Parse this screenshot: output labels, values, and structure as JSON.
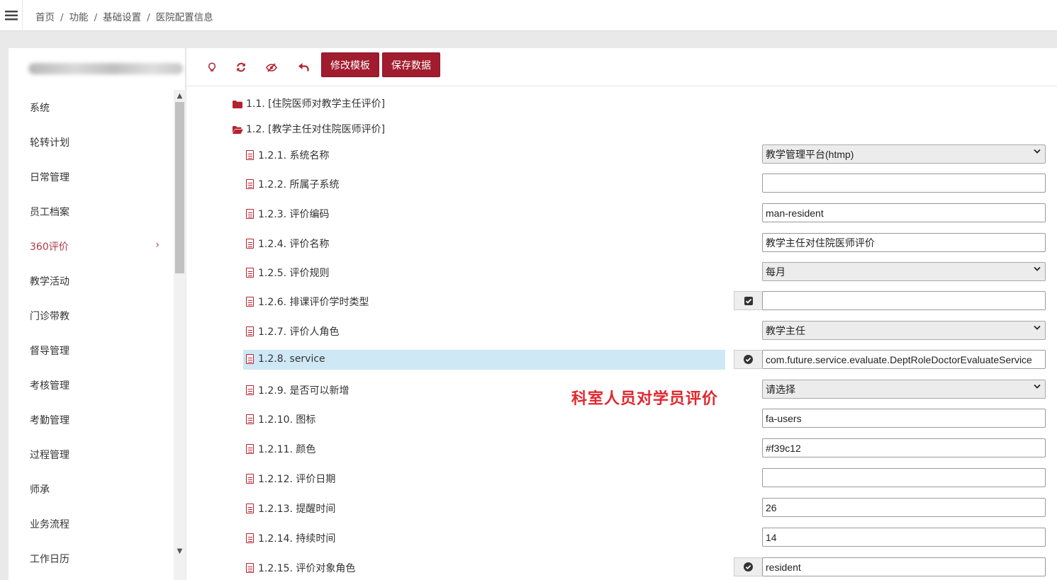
{
  "breadcrumb": [
    "首页",
    "功能",
    "基础设置",
    "医院配置信息"
  ],
  "sidebar": {
    "items": [
      {
        "label": "系统",
        "active": false
      },
      {
        "label": "轮转计划",
        "active": false
      },
      {
        "label": "日常管理",
        "active": false
      },
      {
        "label": "员工档案",
        "active": false
      },
      {
        "label": "360评价",
        "active": true
      },
      {
        "label": "教学活动",
        "active": false
      },
      {
        "label": "门诊带教",
        "active": false
      },
      {
        "label": "督导管理",
        "active": false
      },
      {
        "label": "考核管理",
        "active": false
      },
      {
        "label": "考勤管理",
        "active": false
      },
      {
        "label": "过程管理",
        "active": false
      },
      {
        "label": "师承",
        "active": false
      },
      {
        "label": "业务流程",
        "active": false
      },
      {
        "label": "工作日历",
        "active": false
      }
    ]
  },
  "toolbar": {
    "icons": [
      "lightbulb-icon",
      "refresh-icon",
      "eye-slash-icon",
      "undo-icon"
    ],
    "edit_template": "修改模板",
    "save_data": "保存数据"
  },
  "tree": {
    "node1": "1.1. [住院医师对教学主任评价]",
    "node2": "1.2. [教学主任对住院医师评价]",
    "rows": [
      {
        "label": "1.2.1. 系统名称",
        "type": "select",
        "value": "教学管理平台(htmp)"
      },
      {
        "label": "1.2.2. 所属子系统",
        "type": "input",
        "value": ""
      },
      {
        "label": "1.2.3. 评价编码",
        "type": "input",
        "value": "man-resident"
      },
      {
        "label": "1.2.4. 评价名称",
        "type": "input",
        "value": "教学主任对住院医师评价"
      },
      {
        "label": "1.2.5. 评价规则",
        "type": "select",
        "value": "每月"
      },
      {
        "label": "1.2.6. 排课评价学时类型",
        "type": "input",
        "value": "",
        "addon": "check-square-icon"
      },
      {
        "label": "1.2.7. 评价人角色",
        "type": "select",
        "value": "教学主任"
      },
      {
        "label": "1.2.8. service",
        "type": "input",
        "value": "com.future.service.evaluate.DeptRoleDoctorEvaluateService",
        "addon": "check-circle-icon",
        "highlight": true
      },
      {
        "label": "1.2.9. 是否可以新增",
        "type": "select",
        "value": "请选择"
      },
      {
        "label": "1.2.10. 图标",
        "type": "input",
        "value": "fa-users"
      },
      {
        "label": "1.2.11. 颜色",
        "type": "input",
        "value": "#f39c12"
      },
      {
        "label": "1.2.12. 评价日期",
        "type": "input",
        "value": ""
      },
      {
        "label": "1.2.13. 提醒时间",
        "type": "input",
        "value": "26"
      },
      {
        "label": "1.2.14. 持续时间",
        "type": "input",
        "value": "14"
      },
      {
        "label": "1.2.15. 评价对象角色",
        "type": "input",
        "value": "resident",
        "addon": "check-circle-icon"
      }
    ]
  },
  "annotation": "科室人员对学员评价",
  "colors": {
    "accent": "#a01c2e",
    "active_menu": "#b1394a",
    "highlight": "#cfe8f6"
  }
}
